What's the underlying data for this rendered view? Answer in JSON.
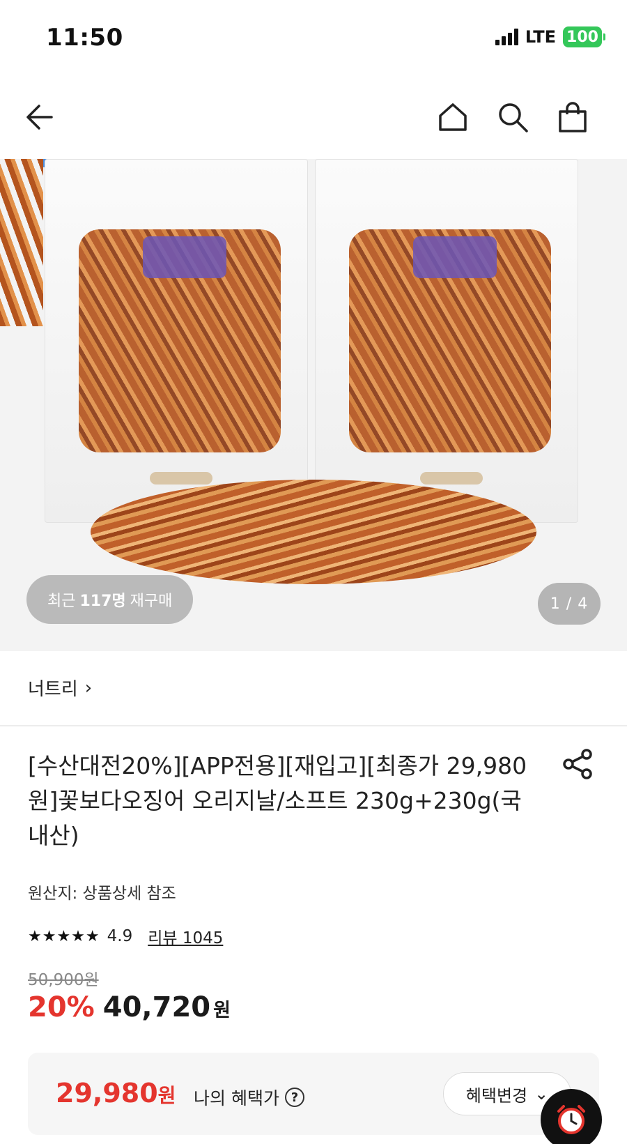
{
  "status_bar": {
    "time": "11:50",
    "network": "LTE",
    "battery": "100",
    "battery_color": "#34c759"
  },
  "nav": {
    "back_icon": "back-arrow-icon",
    "home_icon": "home-icon",
    "search_icon": "search-icon",
    "cart_icon": "shopping-bag-icon"
  },
  "gallery": {
    "repurchase_prefix": "최근",
    "repurchase_count": "117명",
    "repurchase_suffix": "재구매",
    "page_indicator": "1 / 4"
  },
  "store": {
    "name": "너트리",
    "chevron": "›"
  },
  "product": {
    "title": "[수산대전20%][APP전용][재입고][최종가 29,980원]꽃보다오징어 오리지날/소프트 230g+230g(국내산)",
    "origin": "원산지: 상품상세 참조",
    "stars": "★★★★★",
    "rating": "4.9",
    "review": "리뷰 1045",
    "original_price": "50,900원",
    "discount": "20%",
    "sale_price": "40,720",
    "currency": "원"
  },
  "benefit": {
    "price": "29,980",
    "currency": "원",
    "label": "나의 혜택가",
    "help": "?",
    "change_button": "혜택변경",
    "change_chevron": "⌄"
  },
  "colors": {
    "accent_red": "#e4352e",
    "text_dark": "#222222"
  }
}
